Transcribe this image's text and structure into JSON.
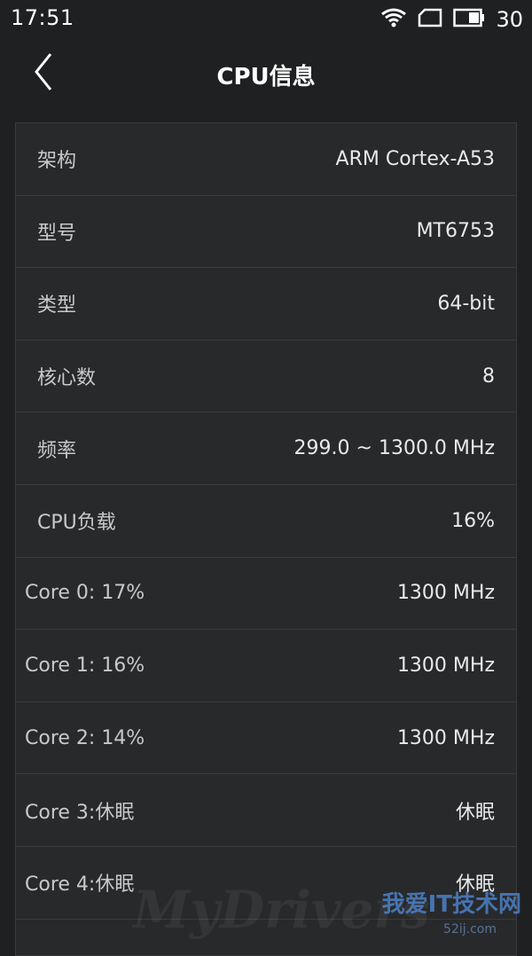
{
  "status_bar": {
    "time": "17:51",
    "battery_level": "30",
    "icons": [
      "wifi-icon",
      "sim-icon",
      "battery-icon"
    ]
  },
  "app_bar": {
    "title": "CPU信息",
    "back_icon": "chevron-left-icon"
  },
  "rows": [
    {
      "label": "架构",
      "value": "ARM Cortex-A53"
    },
    {
      "label": "型号",
      "value": "MT6753"
    },
    {
      "label": "类型",
      "value": "64-bit"
    },
    {
      "label": "核心数",
      "value": "8"
    },
    {
      "label": "频率",
      "value": "299.0 ~ 1300.0 MHz"
    },
    {
      "label": "CPU负载",
      "value": "16%"
    },
    {
      "label": "Core 0: 17%",
      "value": "1300 MHz"
    },
    {
      "label": "Core 1: 16%",
      "value": "1300 MHz"
    },
    {
      "label": "Core 2: 14%",
      "value": "1300 MHz"
    },
    {
      "label": "Core 3:休眠",
      "value": "休眠"
    },
    {
      "label": "Core 4:休眠",
      "value": "休眠"
    }
  ],
  "watermark": {
    "text": "MyDrivers",
    "site_cn": "我爱IT技术网",
    "url": "52ij.com"
  },
  "colors": {
    "background": "#1f2022",
    "card": "#28292b",
    "divider": "#3a3b3e",
    "text_primary": "#ffffff"
  }
}
